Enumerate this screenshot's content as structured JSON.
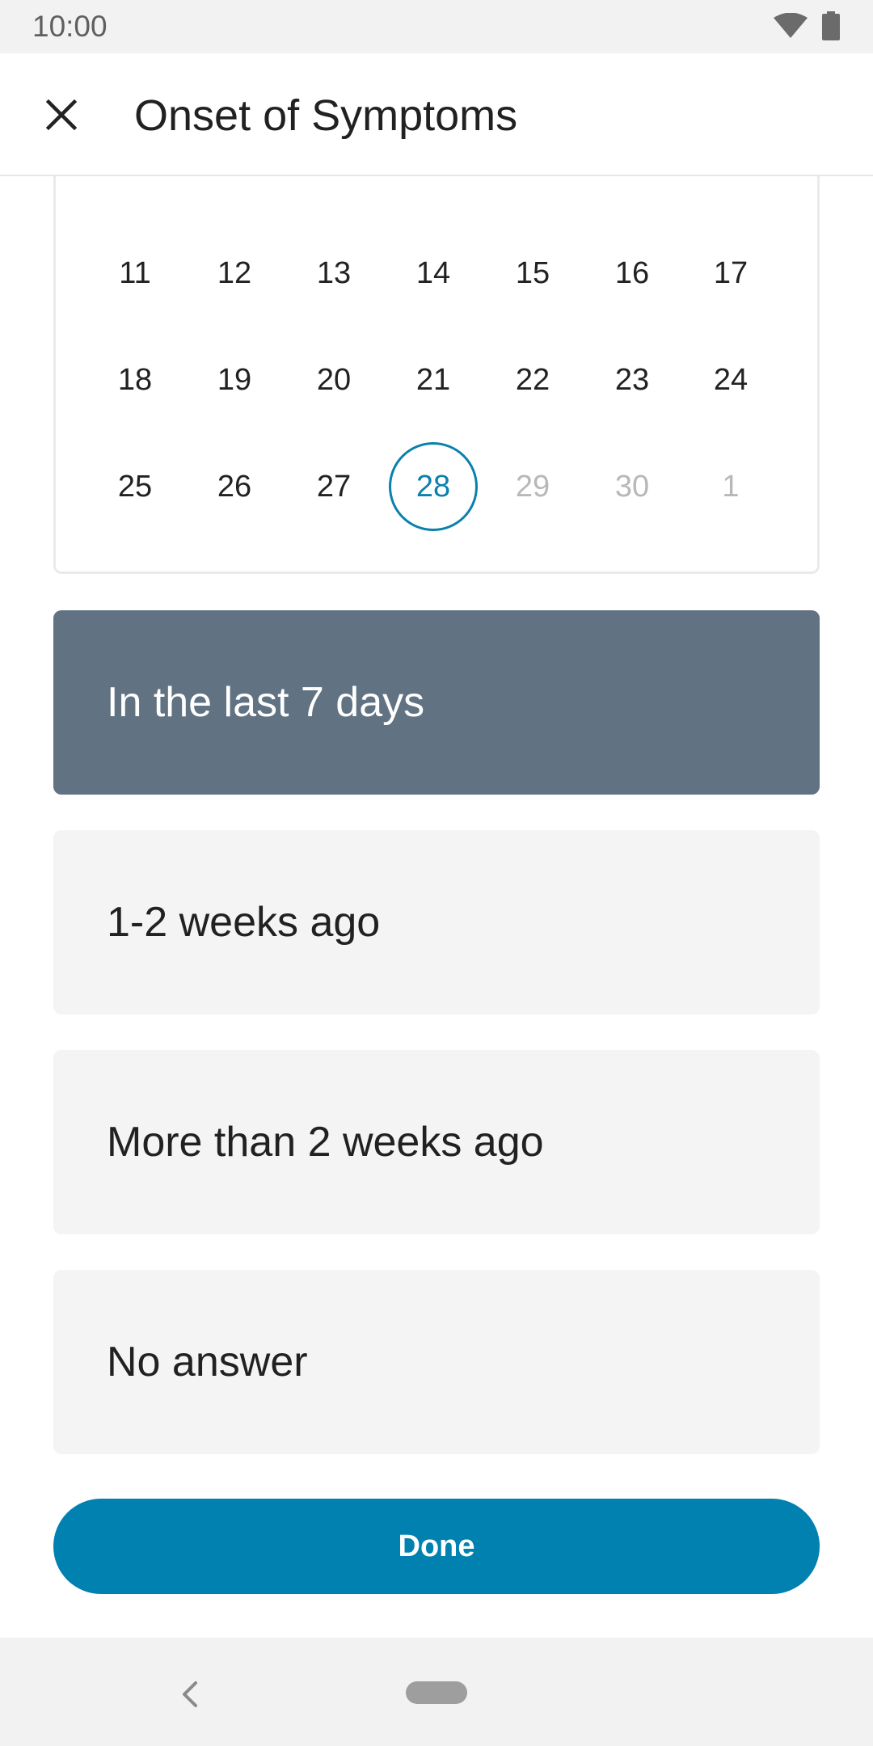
{
  "status_bar": {
    "time": "10:00"
  },
  "header": {
    "title": "Onset of Symptoms"
  },
  "calendar": {
    "week_a": [
      "11",
      "12",
      "13",
      "14",
      "15",
      "16",
      "17"
    ],
    "week_b": [
      "18",
      "19",
      "20",
      "21",
      "22",
      "23",
      "24"
    ],
    "week_c": [
      "25",
      "26",
      "27",
      "28",
      "29",
      "30",
      "1"
    ],
    "selected_day": "28"
  },
  "options": [
    {
      "label": "In the last 7 days",
      "selected": true
    },
    {
      "label": "1-2 weeks ago",
      "selected": false
    },
    {
      "label": "More than 2 weeks ago",
      "selected": false
    },
    {
      "label": "No answer",
      "selected": false
    }
  ],
  "actions": {
    "done_label": "Done"
  },
  "colors": {
    "accent": "#0181b0",
    "selected_option_bg": "#617282",
    "option_bg": "#f4f4f4"
  }
}
